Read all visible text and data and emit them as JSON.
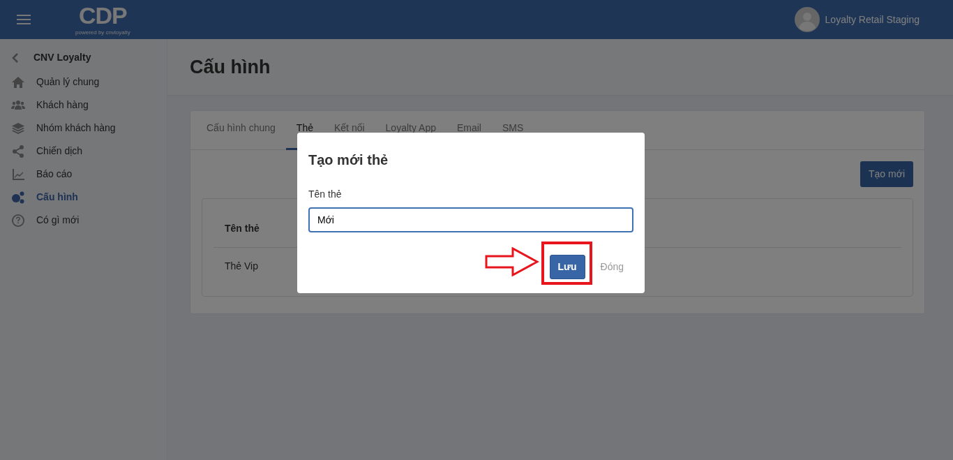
{
  "navbar": {
    "logo": "CDP",
    "logo_tagline": "powered by cnvloyalty",
    "user_name": "Loyalty Retail Staging"
  },
  "sidebar": {
    "back_label": "CNV Loyalty",
    "items": [
      {
        "label": "Quản lý chung",
        "selected": false
      },
      {
        "label": "Khách hàng",
        "selected": false
      },
      {
        "label": "Nhóm khách hàng",
        "selected": false
      },
      {
        "label": "Chiến dịch",
        "selected": false
      },
      {
        "label": "Báo cáo",
        "selected": false
      },
      {
        "label": "Cấu hình",
        "selected": true
      },
      {
        "label": "Có gì mới",
        "selected": false
      }
    ]
  },
  "page_title": "Cấu hình",
  "tabs": [
    {
      "label": "Cấu hình chung",
      "selected": false
    },
    {
      "label": "Thẻ",
      "selected": true
    },
    {
      "label": "Kết nối",
      "selected": false
    },
    {
      "label": "Loyalty App",
      "selected": false
    },
    {
      "label": "Email",
      "selected": false
    },
    {
      "label": "SMS",
      "selected": false
    }
  ],
  "create_button": "Tạo mới",
  "table": {
    "columns": [
      "Tên thẻ"
    ],
    "rows": [
      [
        "Thẻ Vip"
      ]
    ]
  },
  "modal": {
    "title": "Tạo mới thẻ",
    "field_label": "Tên thẻ",
    "field_value": "Mới",
    "save_button": "Lưu",
    "close_button": "Đóng"
  }
}
